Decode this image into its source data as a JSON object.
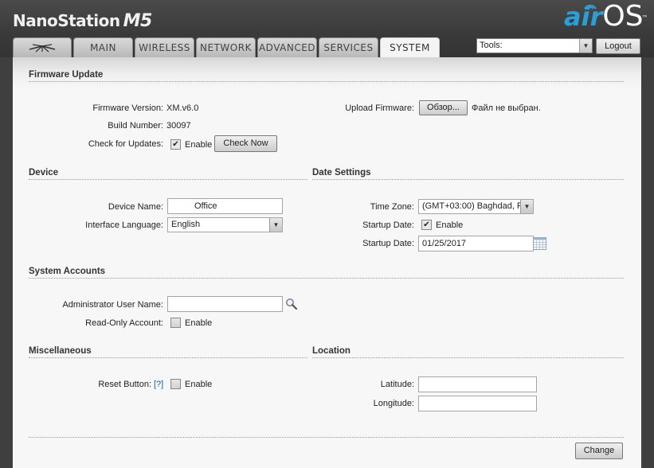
{
  "header": {
    "product_name": "NanoStation",
    "product_model": "M5",
    "logo_air": "air",
    "logo_os": "OS",
    "logo_tm": "™"
  },
  "tabs": [
    {
      "label": "",
      "icon": "ubiquiti-antenna-icon"
    },
    {
      "label": "MAIN"
    },
    {
      "label": "WIRELESS"
    },
    {
      "label": "NETWORK"
    },
    {
      "label": "ADVANCED"
    },
    {
      "label": "SERVICES"
    },
    {
      "label": "SYSTEM",
      "active": true
    }
  ],
  "tools": {
    "selected": "Tools:"
  },
  "logout_label": "Logout",
  "firmware": {
    "title": "Firmware Update",
    "version_label": "Firmware Version:",
    "version_value": "XM.v6.0",
    "build_label": "Build Number:",
    "build_value": "30097",
    "check_label": "Check for Updates:",
    "check_enable_label": "Enable",
    "check_now_label": "Check Now",
    "upload_label": "Upload Firmware:",
    "browse_label": "Обзор...",
    "no_file_label": "Файл не выбран."
  },
  "device": {
    "title": "Device",
    "name_label": "Device Name:",
    "name_value": "Office",
    "language_label": "Interface Language:",
    "language_value": "English"
  },
  "date_settings": {
    "title": "Date Settings",
    "timezone_label": "Time Zone:",
    "timezone_value": "(GMT+03:00) Baghdad, R",
    "startup_label": "Startup Date:",
    "startup_enable_label": "Enable",
    "startup_date_label": "Startup Date:",
    "startup_date_value": "01/25/2017"
  },
  "accounts": {
    "title": "System Accounts",
    "admin_label": "Administrator User Name:",
    "admin_value": "",
    "readonly_label": "Read-Only Account:",
    "readonly_enable_label": "Enable"
  },
  "misc": {
    "title": "Miscellaneous",
    "reset_label": "Reset Button:",
    "reset_help": "[?]",
    "reset_enable_label": "Enable"
  },
  "location": {
    "title": "Location",
    "latitude_label": "Latitude:",
    "latitude_value": "",
    "longitude_label": "Longitude:",
    "longitude_value": ""
  },
  "change_label": "Change"
}
